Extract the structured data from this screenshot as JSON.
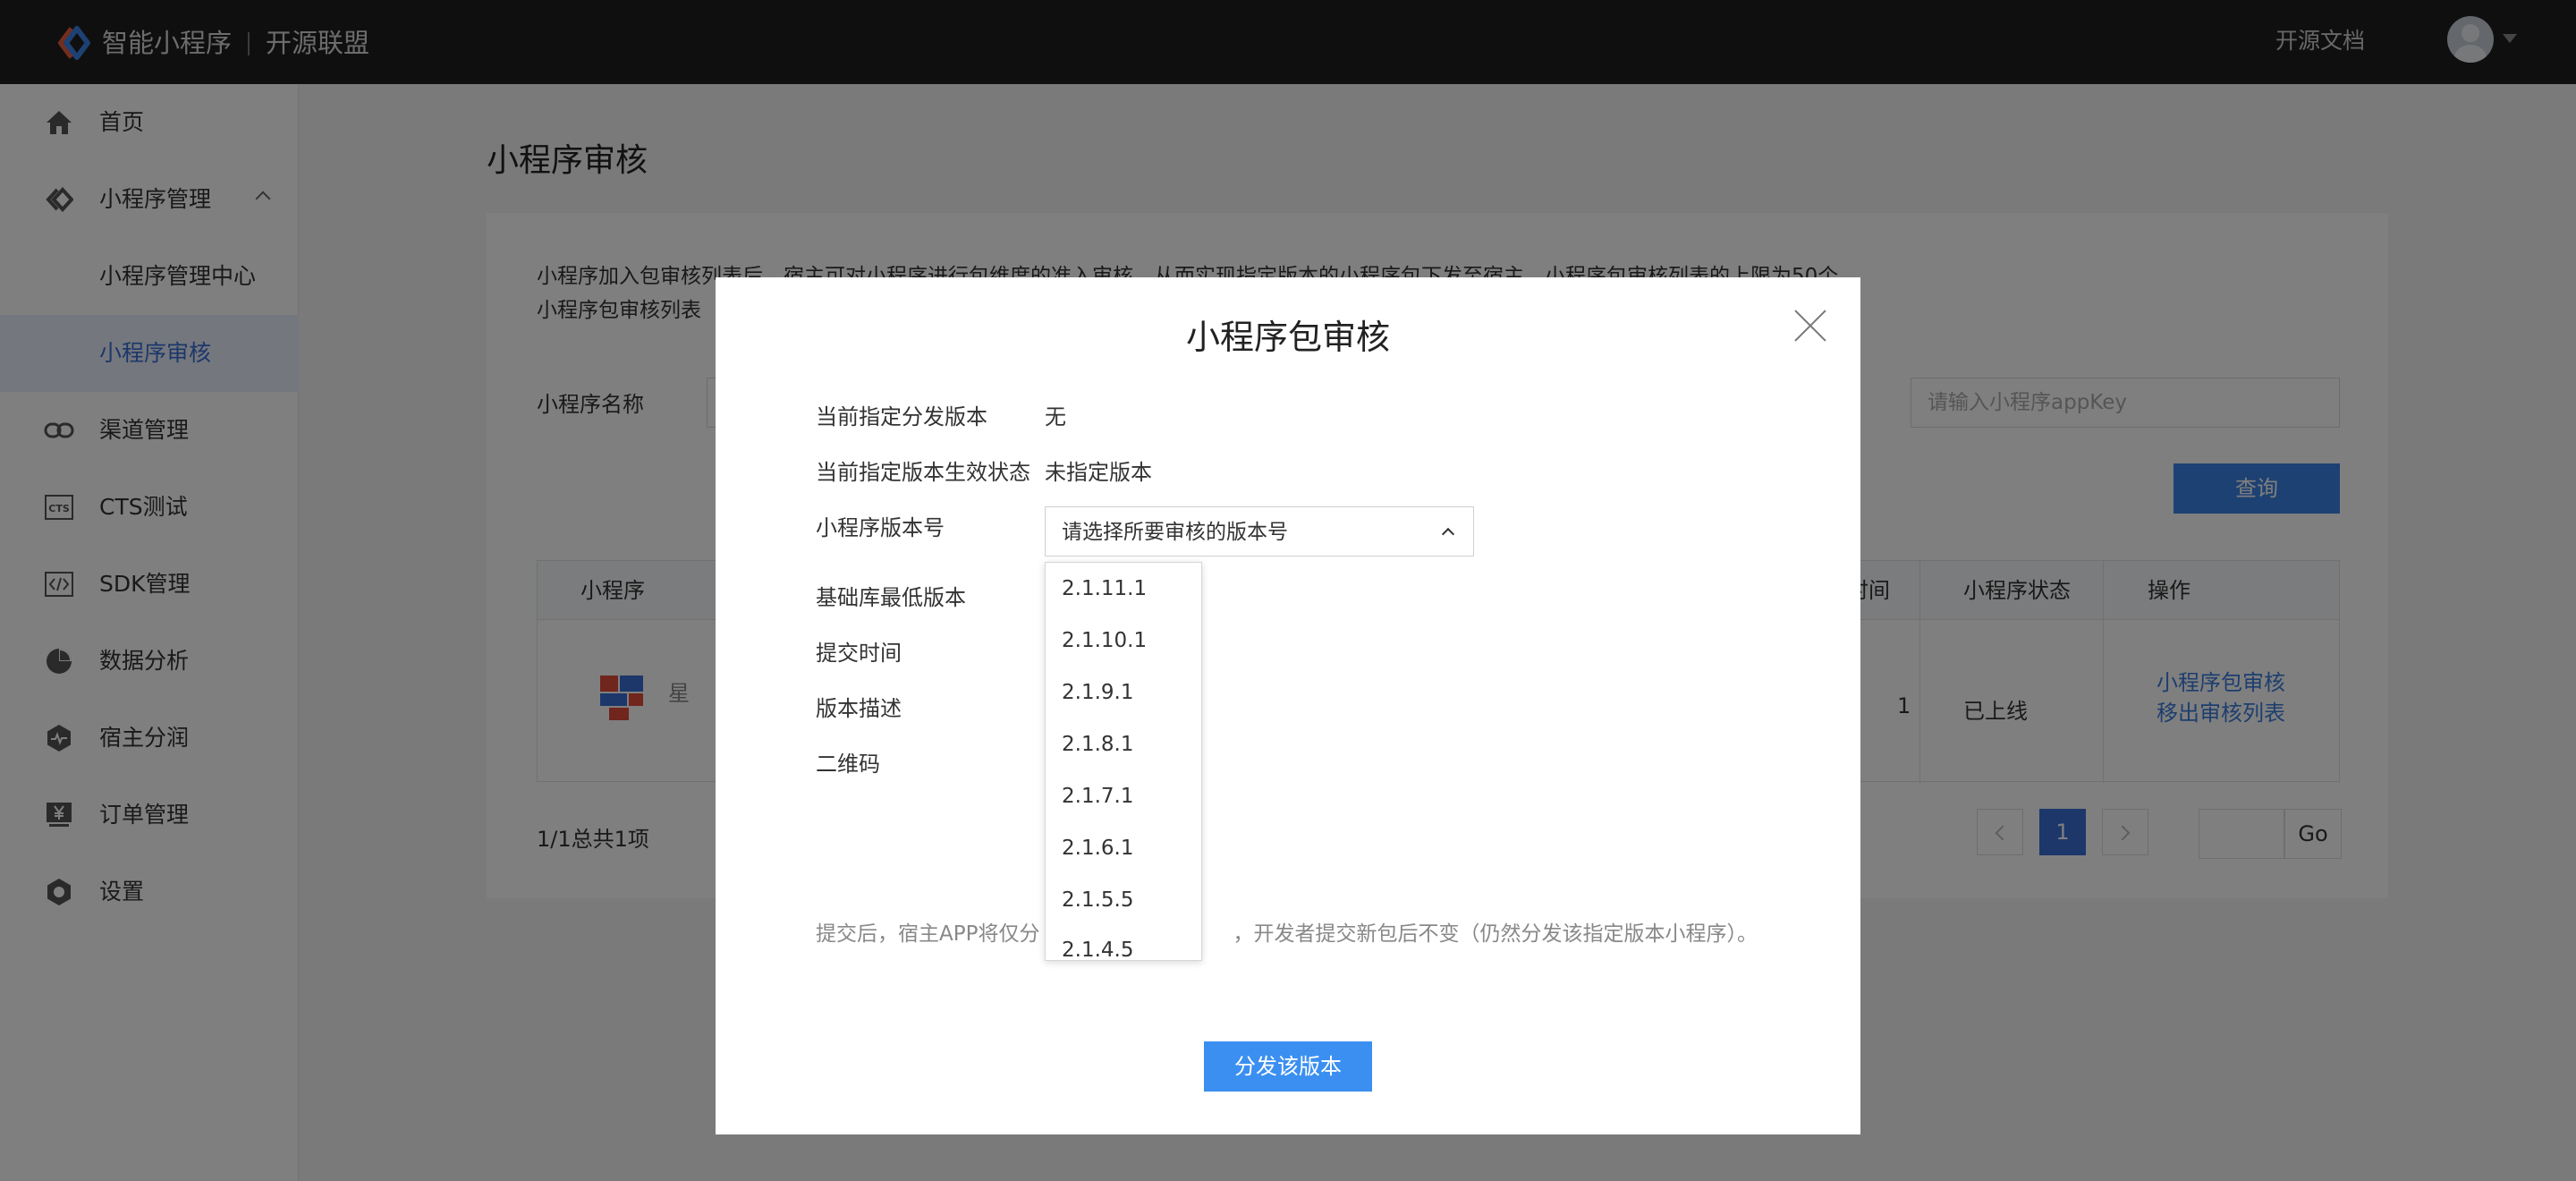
{
  "header": {
    "brand": "智能小程序",
    "brand_sub": "开源联盟",
    "docs_link": "开源文档"
  },
  "sidebar": {
    "items": [
      {
        "label": "首页",
        "icon": "home-icon"
      },
      {
        "label": "小程序管理",
        "icon": "miniapp-icon",
        "expanded": true
      },
      {
        "label": "小程序管理中心",
        "sub": true
      },
      {
        "label": "小程序审核",
        "sub": true,
        "active": true
      },
      {
        "label": "渠道管理",
        "icon": "link-icon"
      },
      {
        "label": "CTS测试",
        "icon": "cts-icon"
      },
      {
        "label": "SDK管理",
        "icon": "code-icon"
      },
      {
        "label": "数据分析",
        "icon": "pie-chart-icon"
      },
      {
        "label": "宿主分润",
        "icon": "pulse-icon"
      },
      {
        "label": "订单管理",
        "icon": "yen-icon"
      },
      {
        "label": "设置",
        "icon": "settings-icon"
      }
    ]
  },
  "main": {
    "title": "小程序审核",
    "intro_line1": "小程序加入包审核列表后，宿主可对小程序进行包维度的准入审核，从而实现指定版本的小程序包下发至宿主。小程序包审核列表的上限为50个。",
    "intro_line2": "小程序包审核列表",
    "filter": {
      "name_label": "小程序名称",
      "appkey_placeholder": "请输入小程序appKey",
      "query_button": "查询"
    },
    "table": {
      "headers": [
        "小程序",
        "时间",
        "小程序状态",
        "操作"
      ],
      "rows": [
        {
          "name_partial": "星",
          "time_partial": "1",
          "status": "已上线",
          "actions": [
            "小程序包审核",
            "移出审核列表"
          ]
        }
      ]
    },
    "pagination": {
      "summary": "1/1总共1项",
      "current_page": "1",
      "go_label": "Go"
    }
  },
  "modal": {
    "title": "小程序包审核",
    "fields": {
      "current_version_label": "当前指定分发版本",
      "current_version_value": "无",
      "status_label": "当前指定版本生效状态",
      "status_value": "未指定版本",
      "version_label": "小程序版本号",
      "version_placeholder": "请选择所要审核的版本号",
      "min_lib_label": "基础库最低版本",
      "submit_time_label": "提交时间",
      "desc_label": "版本描述",
      "qrcode_label": "二维码"
    },
    "version_options": [
      "2.1.11.1",
      "2.1.10.1",
      "2.1.9.1",
      "2.1.8.1",
      "2.1.7.1",
      "2.1.6.1",
      "2.1.5.5",
      "2.1.4.5"
    ],
    "note_left": "提交后，宿主APP将仅分",
    "note_right": "，开发者提交新包后不变（仍然分发该指定版本小程序）。",
    "submit_button": "分发该版本"
  },
  "colors": {
    "topbar": "#1f1f1f",
    "accent": "#3b82e4",
    "link": "#3b7ddd",
    "active_nav_bg": "#e9eefb"
  }
}
